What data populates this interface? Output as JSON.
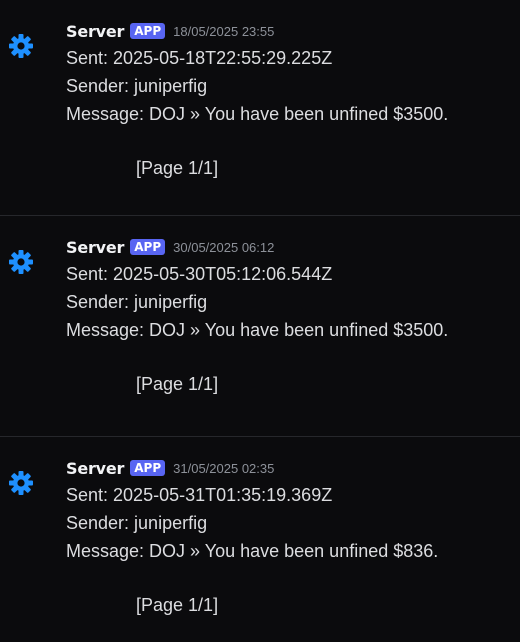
{
  "messages": [
    {
      "author": "Server",
      "badge": "APP",
      "timestamp": "18/05/2025 23:55",
      "avatar_icon": "gear-icon",
      "sent": "Sent: 2025-05-18T22:55:29.225Z",
      "sender": "Sender: juniperfig",
      "message": "Message: DOJ » You have been unfined $3500.",
      "page": "[Page 1/1]"
    },
    {
      "author": "Server",
      "badge": "APP",
      "timestamp": "30/05/2025 06:12",
      "avatar_icon": "gear-icon",
      "sent": "Sent: 2025-05-30T05:12:06.544Z",
      "sender": "Sender: juniperfig",
      "message": "Message: DOJ » You have been unfined $3500.",
      "page": "[Page 1/1]"
    },
    {
      "author": "Server",
      "badge": "APP",
      "timestamp": "31/05/2025 02:35",
      "avatar_icon": "gear-icon",
      "sent": "Sent: 2025-05-31T01:35:19.369Z",
      "sender": "Sender: juniperfig",
      "message": "Message: DOJ » You have been unfined $836.",
      "page": "[Page 1/1]"
    }
  ],
  "colors": {
    "background": "#0b0b0d",
    "badge": "#5865f2",
    "icon": "#1e90ff",
    "timestamp": "#8d9199",
    "divider": "#26272b"
  }
}
